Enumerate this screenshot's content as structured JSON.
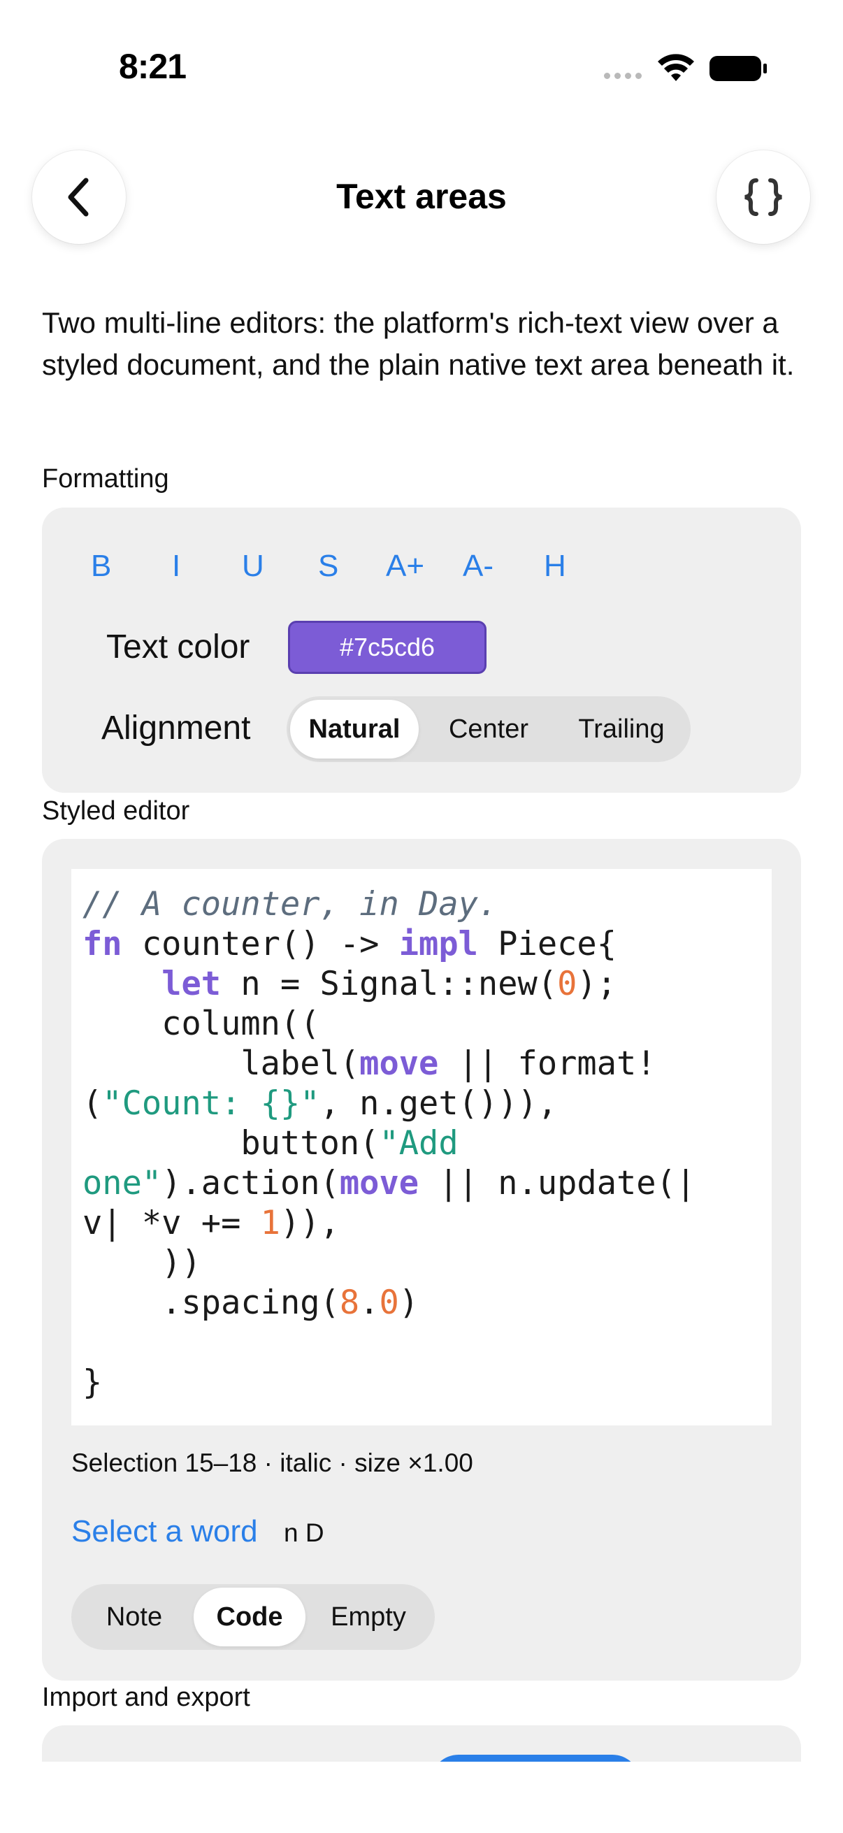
{
  "status_bar": {
    "time": "8:21"
  },
  "nav": {
    "title": "Text areas",
    "back_icon": "chevron-left-icon",
    "code_icon": "braces-icon"
  },
  "description": "Two multi-line editors: the platform's rich-text view over a styled document, and the plain native text area beneath it.",
  "formatting": {
    "label": "Formatting",
    "buttons": [
      "B",
      "I",
      "U",
      "S",
      "A+",
      "A-",
      "H"
    ],
    "text_color_label": "Text color",
    "text_color_value": "#7c5cd6",
    "alignment_label": "Alignment",
    "alignment_options": [
      "Natural",
      "Center",
      "Trailing"
    ],
    "alignment_selected": "Natural"
  },
  "styled_editor": {
    "label": "Styled editor",
    "code": {
      "comment": "// A counter, in Day.",
      "fn": "fn",
      "counter_sig": " counter() -> ",
      "impl": "impl",
      "piece": " Piece{",
      "let_indent": "    ",
      "let": "let",
      "let_rest": " n = Signal::new(",
      "zero": "0",
      "close_semi": ");",
      "column": "    column((",
      "label_indent": "        label(",
      "move": "move",
      "pipes_format": " || format!",
      "format_open": "(",
      "count_str": "\"Count: {}\"",
      "format_tail": ", n.get())),",
      "button_indent": "        button(",
      "add_str_1": "\"Add",
      "add_str_2": "one\"",
      "action_open": ").action(",
      "update_call": " || n.update(|",
      "v_line": "v| *v += ",
      "one": "1",
      "v_close": ")),",
      "close_parens": "    ))",
      "spacing_open": "    .spacing(",
      "eight": "8",
      "dot": ".",
      "spacing_close": ")",
      "closing_brace": "}"
    },
    "selection_info": "Selection 15–18 · italic · size ×1.00",
    "select_word_link": "Select a word",
    "selected_word": "n D",
    "mode_options": [
      "Note",
      "Code",
      "Empty"
    ],
    "mode_selected": "Code"
  },
  "import_export": {
    "label": "Import and export"
  },
  "colors": {
    "accent": "#2a7fe8",
    "keyword": "#7c5cd6",
    "number": "#e8733a",
    "string": "#1f9a7f",
    "comment": "#5d6d7e"
  }
}
